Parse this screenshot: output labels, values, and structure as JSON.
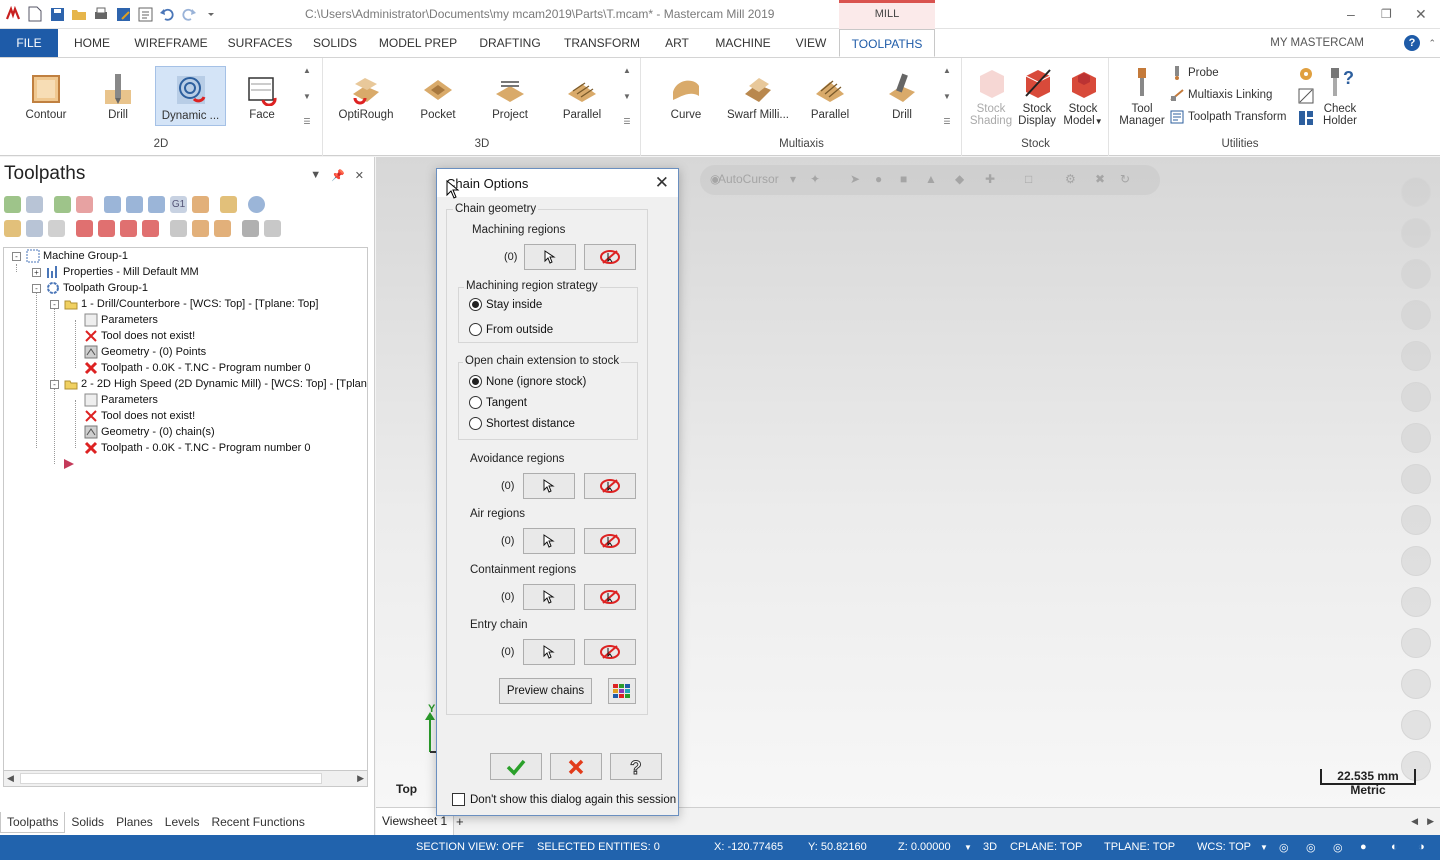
{
  "app": {
    "title": "C:\\Users\\Administrator\\Documents\\my mcam2019\\Parts\\T.mcam* - Mastercam Mill 2019",
    "context_tab": "MILL",
    "my_mastercam": "MY MASTERCAM",
    "help_glyph": "?"
  },
  "ribbon_tabs": [
    "FILE",
    "HOME",
    "WIREFRAME",
    "SURFACES",
    "SOLIDS",
    "MODEL PREP",
    "DRAFTING",
    "TRANSFORM",
    "ART",
    "MACHINE",
    "VIEW",
    "TOOLPATHS"
  ],
  "ribbon": {
    "group_2d": {
      "label": "2D",
      "buttons": [
        "Contour",
        "Drill",
        "Dynamic ...",
        "Face"
      ]
    },
    "group_3d": {
      "label": "3D",
      "buttons": [
        "OptiRough",
        "Pocket",
        "Project",
        "Parallel"
      ]
    },
    "group_multiaxis": {
      "label": "Multiaxis",
      "buttons": [
        "Curve",
        "Swarf Milli...",
        "Parallel",
        "Drill"
      ]
    },
    "group_stock": {
      "label": "Stock",
      "b1a": "Stock",
      "b1b": "Shading",
      "b2a": "Stock",
      "b2b": "Display",
      "b3a": "Stock",
      "b3b": "Model"
    },
    "group_utilities": {
      "label": "Utilities",
      "tool_a": "Tool",
      "tool_b": "Manager",
      "probe": "Probe",
      "multiaxis_linking": "Multiaxis Linking",
      "toolpath_transform": "Toolpath Transform",
      "check_a": "Check",
      "check_b": "Holder"
    }
  },
  "toolpaths_panel": {
    "title": "Toolpaths",
    "tree": [
      "Machine Group-1",
      "Properties - Mill Default MM",
      "Toolpath Group-1",
      "1 - Drill/Counterbore - [WCS: Top] - [Tplane: Top]",
      "Parameters",
      "Tool does not exist!",
      "Geometry - (0) Points",
      "Toolpath - 0.0K - T.NC - Program number 0",
      "2 - 2D High Speed (2D Dynamic Mill) - [WCS: Top] - [Tplane",
      "Parameters",
      "Tool does not exist!",
      "Geometry - (0) chain(s)",
      "Toolpath - 0.0K - T.NC - Program number 0"
    ],
    "bottom_tabs": [
      "Toolpaths",
      "Solids",
      "Planes",
      "Levels",
      "Recent Functions"
    ]
  },
  "viewport": {
    "toolbar_autocursor": "AutoCursor",
    "view_name": "Top",
    "axis_y": "Y",
    "scale_value": "22.535 mm",
    "scale_unit": "Metric",
    "sheet_tab": "Viewsheet 1",
    "add_sheet": "+"
  },
  "dialog": {
    "title": "Chain Options",
    "chain_geometry": "Chain geometry",
    "machining_regions": {
      "label": "Machining regions",
      "count": "(0)"
    },
    "region_strategy": {
      "label": "Machining region strategy",
      "options": [
        "Stay inside",
        "From outside"
      ],
      "selected": "Stay inside"
    },
    "open_chain": {
      "label": "Open chain extension to stock",
      "options": [
        "None (ignore stock)",
        "Tangent",
        "Shortest distance"
      ],
      "selected": "None (ignore stock)"
    },
    "avoidance_regions": {
      "label": "Avoidance regions",
      "count": "(0)"
    },
    "air_regions": {
      "label": "Air regions",
      "count": "(0)"
    },
    "containment_regions": {
      "label": "Containment regions",
      "count": "(0)"
    },
    "entry_chain": {
      "label": "Entry chain",
      "count": "(0)"
    },
    "preview_chains": "Preview chains",
    "dont_show": "Don't show this dialog again this session"
  },
  "status": {
    "section_view": "SECTION VIEW: OFF",
    "selected": "SELECTED ENTITIES: 0",
    "x": "X:  -120.77465",
    "y": "Y:  50.82160",
    "z": "Z:  0.00000",
    "mode": "3D",
    "cplane": "CPLANE: TOP",
    "tplane": "TPLANE: TOP",
    "wcs": "WCS: TOP"
  },
  "colors": {
    "accent": "#1e5ba8",
    "status": "#2163ad",
    "error": "#d9534f"
  }
}
